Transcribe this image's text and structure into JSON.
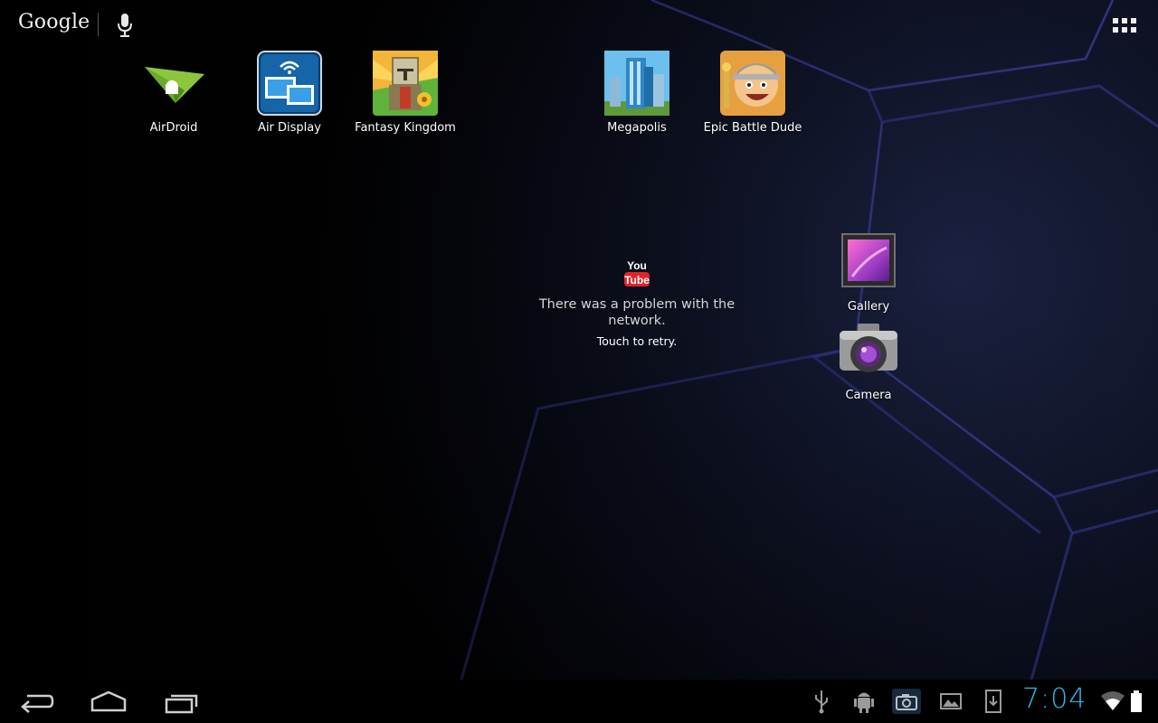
{
  "search": {
    "logo_text": "Google"
  },
  "desktop": {
    "shortcuts": [
      {
        "label": "AirDroid",
        "icon": "airdroid-icon"
      },
      {
        "label": "Air Display",
        "icon": "air-display-icon"
      },
      {
        "label": "Fantasy Kingdom",
        "icon": "fantasy-kingdom-icon"
      },
      {
        "label": "Megapolis",
        "icon": "megapolis-icon"
      },
      {
        "label": "Epic Battle Dude",
        "icon": "epic-battle-dude-icon"
      },
      {
        "label": "Gallery",
        "icon": "gallery-icon"
      },
      {
        "label": "Camera",
        "icon": "camera-icon"
      }
    ]
  },
  "youtube_widget": {
    "logo_top": "You",
    "logo_bottom": "Tube",
    "message": "There was a problem with the network.",
    "retry": "Touch to retry."
  },
  "status_bar": {
    "time": "7:04",
    "accent_color": "#33b5e5"
  }
}
